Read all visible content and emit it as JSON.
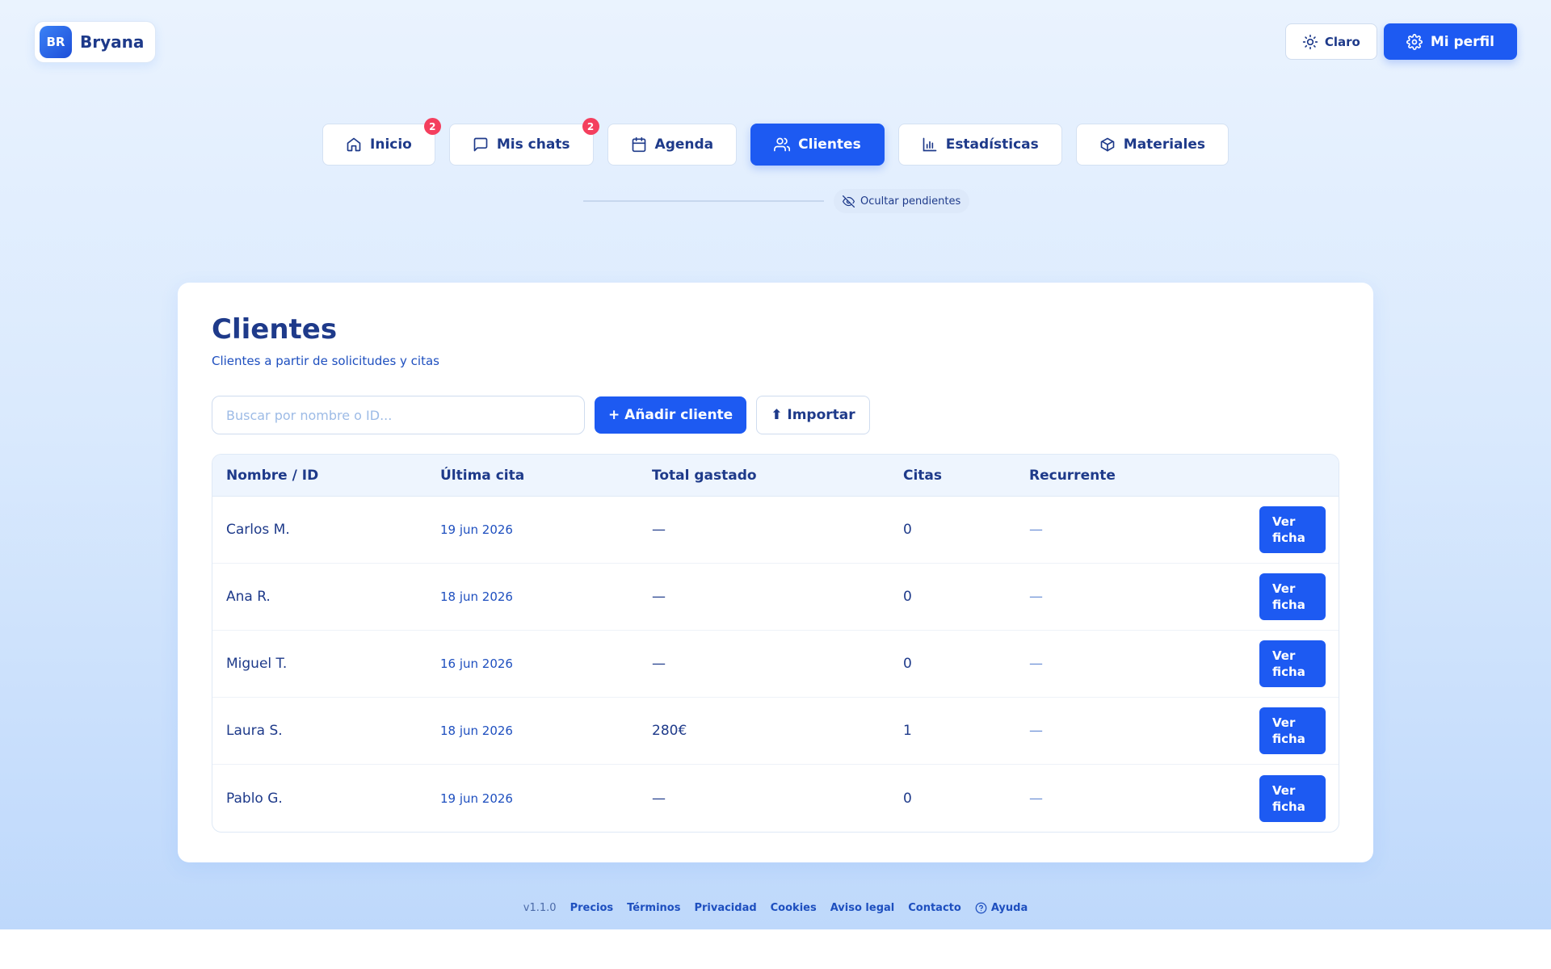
{
  "brand": {
    "initials": "BR",
    "name": "Bryana"
  },
  "header": {
    "theme_label": "Claro",
    "profile_label": "Mi perfil"
  },
  "nav": {
    "items": [
      {
        "label": "Inicio",
        "badge": "2"
      },
      {
        "label": "Mis chats",
        "badge": "2"
      },
      {
        "label": "Agenda"
      },
      {
        "label": "Clientes",
        "active": true
      },
      {
        "label": "Estadísticas"
      },
      {
        "label": "Materiales"
      }
    ],
    "hide_pending_label": "Ocultar pendientes"
  },
  "main": {
    "title": "Clientes",
    "subtitle": "Clientes a partir de solicitudes y citas",
    "search": {
      "placeholder": "Buscar por nombre o ID...",
      "value": ""
    },
    "add_label": "+ Añadir cliente",
    "import_label": "⬆ Importar",
    "table": {
      "headers": [
        "Nombre / ID",
        "Última cita",
        "Total gastado",
        "Citas",
        "Recurrente"
      ],
      "view_label": "Ver ficha",
      "rows": [
        {
          "name": "Carlos M.",
          "last": "19 jun 2026",
          "total": "—",
          "citas": "0",
          "recurrente": "—"
        },
        {
          "name": "Ana R.",
          "last": "18 jun 2026",
          "total": "—",
          "citas": "0",
          "recurrente": "—"
        },
        {
          "name": "Miguel T.",
          "last": "16 jun 2026",
          "total": "—",
          "citas": "0",
          "recurrente": "—"
        },
        {
          "name": "Laura S.",
          "last": "18 jun 2026",
          "total": "280€",
          "citas": "1",
          "recurrente": "—"
        },
        {
          "name": "Pablo G.",
          "last": "19 jun 2026",
          "total": "—",
          "citas": "0",
          "recurrente": "—"
        }
      ]
    }
  },
  "footer": {
    "version": "v1.1.0",
    "links": [
      "Precios",
      "Términos",
      "Privacidad",
      "Cookies",
      "Aviso legal",
      "Contacto"
    ],
    "help_label": "Ayuda"
  },
  "colors": {
    "accent": "#1d5af2",
    "badge": "#f43f5e",
    "text": "#1e3a8a"
  }
}
